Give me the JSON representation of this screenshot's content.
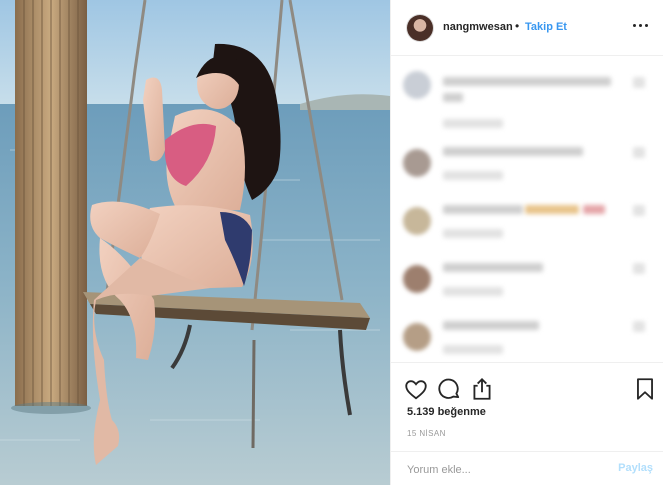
{
  "post": {
    "username": "nangmwesan",
    "separator": "•",
    "follow_label": "Takip Et",
    "likes": "5.139 beğenme",
    "date": "15 NİSAN"
  },
  "comment_box": {
    "placeholder": "Yorum ekle...",
    "post_label": "Paylaş"
  },
  "icons": {
    "more": "more-options-icon",
    "like": "heart-icon",
    "comment": "comment-icon",
    "share": "share-icon",
    "save": "bookmark-icon"
  },
  "colors": {
    "link": "#3897f0",
    "post_disabled": "#b2dffc",
    "text": "#262626",
    "muted": "#999999",
    "divider": "#efefef"
  }
}
